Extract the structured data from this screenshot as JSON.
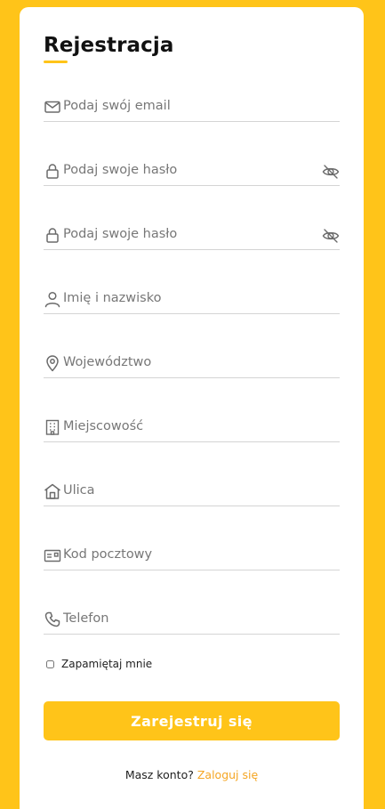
{
  "form": {
    "title": "Rejestracja",
    "fields": [
      {
        "icon": "envelope-icon",
        "placeholder": "Podaj swój email",
        "value": ""
      },
      {
        "icon": "lock-icon",
        "placeholder": "Podaj swoje hasło",
        "value": ""
      },
      {
        "icon": "lock-icon",
        "placeholder": "Podaj swoje hasło",
        "value": ""
      },
      {
        "icon": "user-icon",
        "placeholder": "Imię i nazwisko",
        "value": ""
      },
      {
        "icon": "map-pin-icon",
        "placeholder": "Województwo",
        "value": ""
      },
      {
        "icon": "building-icon",
        "placeholder": "Miejscowość",
        "value": ""
      },
      {
        "icon": "house-icon",
        "placeholder": "Ulica",
        "value": ""
      },
      {
        "icon": "postcard-icon",
        "placeholder": "Kod pocztowy",
        "value": ""
      },
      {
        "icon": "phone-icon",
        "placeholder": "Telefon",
        "value": ""
      }
    ],
    "password_toggle_icon": "eye-slash-icon",
    "remember_label": "Zapamiętaj mnie",
    "remember_checked": false,
    "submit_label": "Zarejestruj się",
    "footer_text": "Masz konto?",
    "footer_link": "Zaloguj się"
  },
  "colors": {
    "background": "#FFC419",
    "accent": "#FFC419",
    "link": "#F5A623"
  }
}
